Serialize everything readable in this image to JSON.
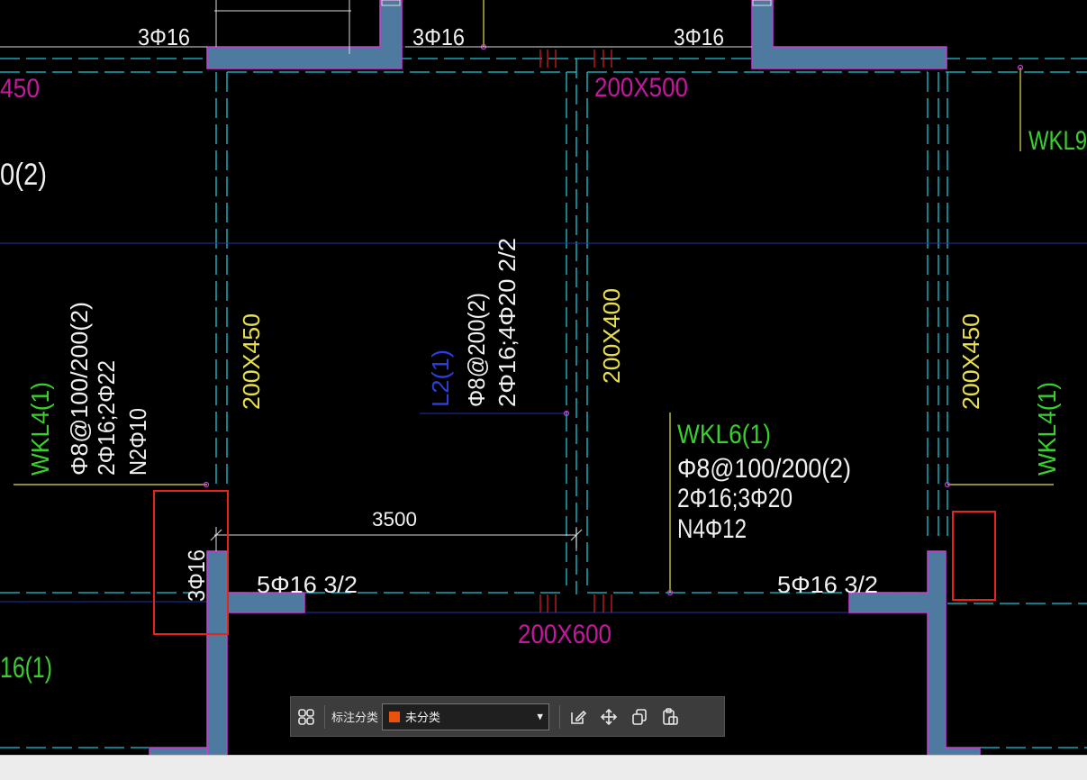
{
  "colors": {
    "background": "#000000",
    "wall_fill": "#4f7aa0",
    "wall_outline": "#c73cd2",
    "axis_cyan": "#1fc6d6",
    "text_white": "#f0f0f0",
    "text_yellow": "#e8e04a",
    "text_green": "#38d12b",
    "text_magenta": "#c6179e",
    "text_blue": "#2b3ee0",
    "highlight_red": "#e8231c",
    "category_swatch": "#e8520c"
  },
  "drawing": {
    "top_labels": {
      "rebar_left": "3Φ16",
      "rebar_mid": "3Φ16",
      "rebar_right": "3Φ16"
    },
    "beams": {
      "top_section": "200X500",
      "left_partial": "450",
      "left_partial_2": "0(2)",
      "left_section": "200X450",
      "mid_section": "200X400",
      "right_section": "200X450",
      "bottom_section": "200X600"
    },
    "wkl4_left": {
      "name": "WKL4(1)",
      "stirrup": "Φ8@100/200(2)",
      "bars": "2Φ16;2Φ22",
      "torsion": "N2Φ10"
    },
    "l2": {
      "name": "L2(1)",
      "stirrup": "Φ8@200(2)",
      "bars": "2Φ16;4Φ20 2/2"
    },
    "wkl6": {
      "name": "WKL6(1)",
      "stirrup": "Φ8@100/200(2)",
      "bars": "2Φ16;3Φ20",
      "torsion": "N4Φ12"
    },
    "wkl4_right": {
      "name": "WKL4(1)"
    },
    "wkl9": {
      "name": "WKL9"
    },
    "bottom_left_partial": "16(1)",
    "dimension": "3500",
    "bottom_rebar_left": "5Φ16 3/2",
    "bottom_rebar_right": "5Φ16 3/2",
    "left_column_rebar": "3Φ16"
  },
  "toolbar": {
    "grid_icon": "grid-icon",
    "label": "标注分类",
    "category_value": "未分类",
    "dropdown_icon": "chevron-down-icon",
    "tools": [
      {
        "name": "edit-icon"
      },
      {
        "name": "move-icon"
      },
      {
        "name": "copy-icon"
      },
      {
        "name": "paste-icon"
      }
    ]
  }
}
